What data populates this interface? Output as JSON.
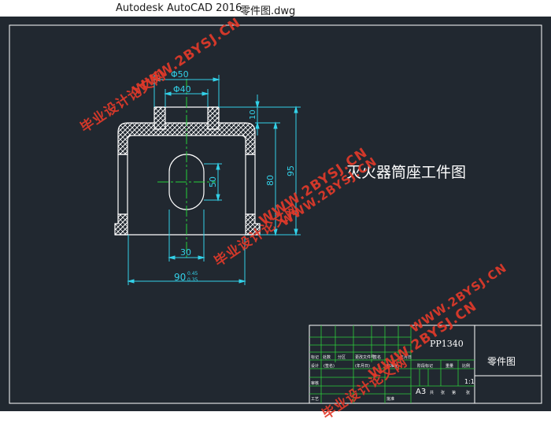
{
  "titlebar": {
    "app_name": "Autodesk AutoCAD 2016",
    "file_name": "零件图.dwg"
  },
  "drawing": {
    "title": "灭火器筒座工件图",
    "dim_phi_outer": "Φ50",
    "dim_phi_inner": "Φ40",
    "dim_slot_width": "30",
    "dim_bottom_width": "90",
    "dim_bottom_tol_upper": "0.45",
    "dim_bottom_tol_lower": "0.35",
    "dim_top": "10",
    "dim_slot_height": "50",
    "dim_inner_height": "80",
    "dim_total_height": "95"
  },
  "title_block": {
    "part_no": "PP1340",
    "part_name": "零件图",
    "sheet_size": "A3",
    "scale": "1:1",
    "cells": [
      "标记",
      "处数",
      "分区",
      "更改文件号",
      "签名",
      "年月日",
      "设计",
      "(签名)",
      "(年月日)",
      "标准化",
      "阶段标记",
      "重量",
      "比例",
      "审核",
      "工艺",
      "批准",
      "共",
      "张",
      "第",
      "张"
    ]
  },
  "watermarks": [
    "毕业设计论文网",
    "WWW.2BYSJ.CN"
  ],
  "colors": {
    "canvas_bg": "#212830",
    "geometry": "#ffffff",
    "dimension": "#33d1e8",
    "centerline": "#25d13a",
    "watermark": "#e23a2a"
  }
}
